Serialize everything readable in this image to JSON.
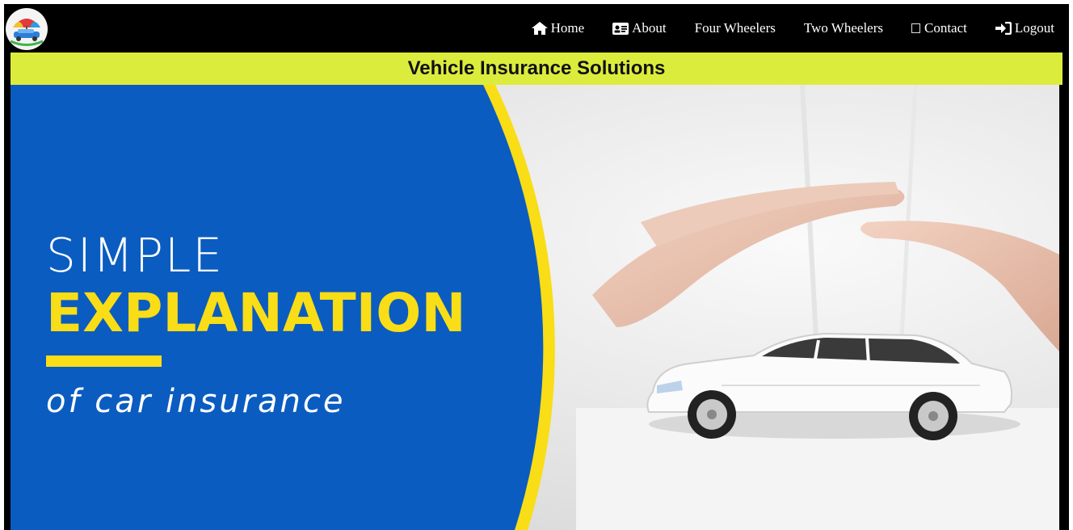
{
  "nav": {
    "items": [
      {
        "label": "Home",
        "icon": "home-icon"
      },
      {
        "label": "About",
        "icon": "id-card-icon"
      },
      {
        "label": "Four Wheelers",
        "icon": ""
      },
      {
        "label": "Two Wheelers",
        "icon": ""
      },
      {
        "label": "Contact",
        "icon": "box-icon"
      },
      {
        "label": "Logout",
        "icon": "sign-in-icon"
      }
    ]
  },
  "header": {
    "title": "Vehicle Insurance Solutions"
  },
  "hero": {
    "line1": "SIMPLE",
    "line2": "EXPLANATION",
    "line3": "of car insurance"
  },
  "colors": {
    "navbar_bg": "#000000",
    "title_bar_bg": "#dcec3d",
    "hero_blue": "#0b5cc0",
    "hero_yellow": "#f9dd16"
  }
}
